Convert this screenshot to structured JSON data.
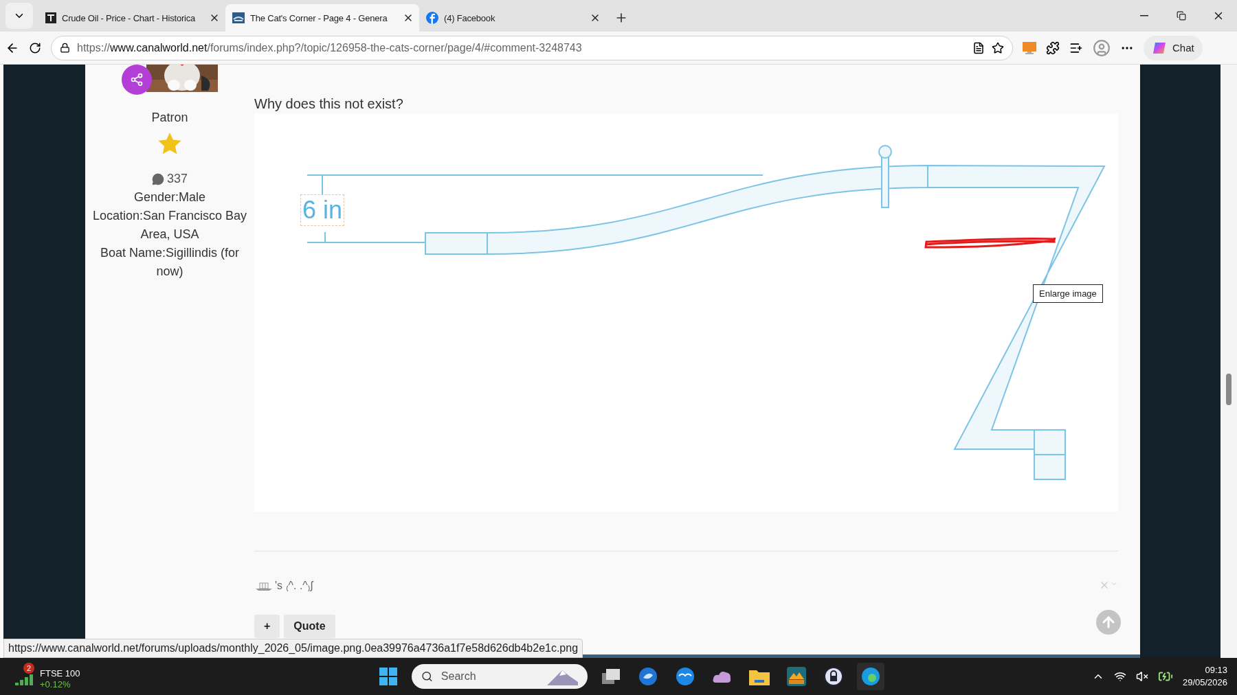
{
  "browser": {
    "tabs": [
      {
        "kind": "te",
        "title": "Crude Oil - Price - Chart - Historica",
        "selected": false
      },
      {
        "kind": "canal",
        "title": "The Cat's Corner - Page 4 - Genera",
        "selected": true
      },
      {
        "kind": "facebook",
        "title": "(4) Facebook",
        "selected": false
      }
    ],
    "url_host_prefix": "https://",
    "url_host": "www.canalworld.net",
    "url_path": "/forums/index.php?/topic/126958-the-cats-corner/page/4/#comment-3248743",
    "chat_label": "Chat"
  },
  "profile": {
    "title": "Patron",
    "post_count": "337",
    "fields": [
      "Gender:Male",
      "Location:San Francisco Bay Area, USA",
      "Boat Name:Sigillindis (for now)"
    ]
  },
  "post": {
    "question": "Why does this not exist?",
    "diagram": {
      "dimension_label": "6 in"
    },
    "tooltip": "Enlarge image",
    "signature": "'s ₍^. .^₎ʃ",
    "buttons": [
      "+",
      "Quote"
    ]
  },
  "status_url": "https://www.canalworld.net/forums/uploads/monthly_2026_05/image.png.0ea39976a4736a1f7e58d626db4b2e1c.png",
  "taskbar": {
    "widget_badge": "2",
    "widget_title": "FTSE 100",
    "widget_change": "+0.12%",
    "search_placeholder": "Search",
    "time": "09:13",
    "date": "29/05/2026"
  }
}
